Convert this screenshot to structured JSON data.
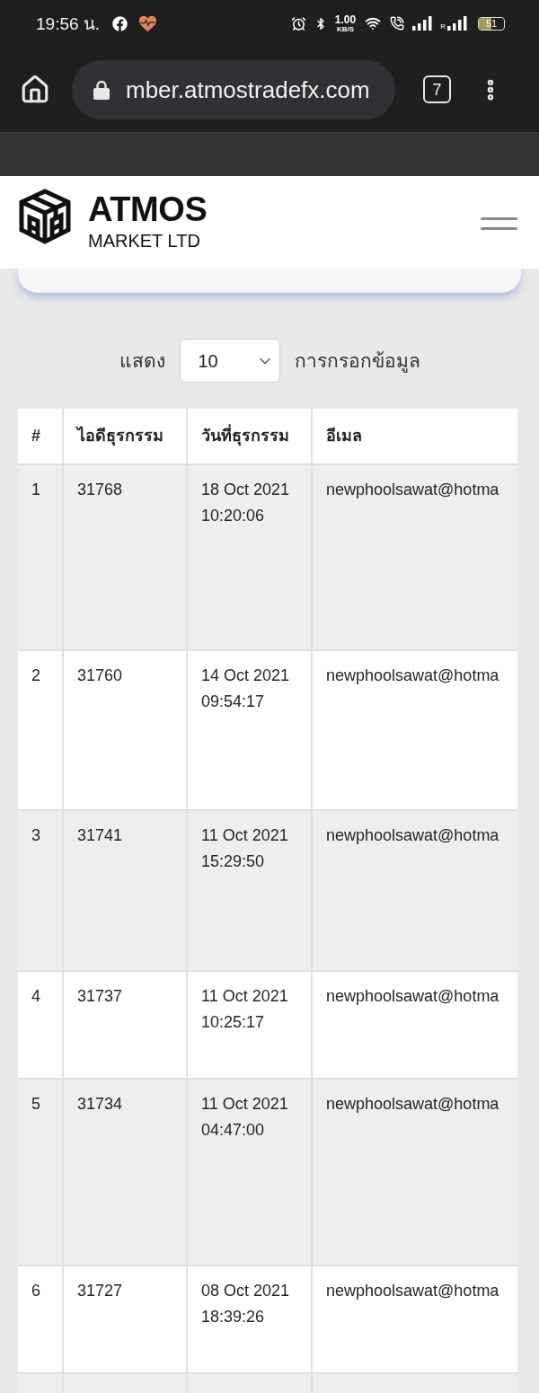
{
  "status_bar": {
    "time": "19:56 น.",
    "net_speed": "1.00",
    "net_speed_unit": "KB/S",
    "roaming_label": "R",
    "battery": "51"
  },
  "browser": {
    "url": "mber.atmostradefx.com",
    "tab_count": "7"
  },
  "header": {
    "brand": "ATMOS",
    "brand_sub": "MARKET LTD"
  },
  "entries": {
    "label_before": "แสดง",
    "value": "10",
    "label_after": "การกรอกข้อมูล"
  },
  "table": {
    "columns": [
      "#",
      "ไอดีธุรกรรม",
      "วันที่ธุรกรรม",
      "อีเมล"
    ],
    "rows": [
      {
        "no": "1",
        "id": "31768",
        "datetime": "18 Oct 2021 10:20:06",
        "email": "newphoolsawat@hotma"
      },
      {
        "no": "2",
        "id": "31760",
        "datetime": "14 Oct 2021 09:54:17",
        "email": "newphoolsawat@hotma"
      },
      {
        "no": "3",
        "id": "31741",
        "datetime": "11 Oct 2021 15:29:50",
        "email": "newphoolsawat@hotma"
      },
      {
        "no": "4",
        "id": "31737",
        "datetime": "11 Oct 2021 10:25:17",
        "email": "newphoolsawat@hotma"
      },
      {
        "no": "5",
        "id": "31734",
        "datetime": "11 Oct 2021 04:47:00",
        "email": "newphoolsawat@hotma"
      },
      {
        "no": "6",
        "id": "31727",
        "datetime": "08 Oct 2021 18:39:26",
        "email": "newphoolsawat@hotma"
      }
    ]
  }
}
